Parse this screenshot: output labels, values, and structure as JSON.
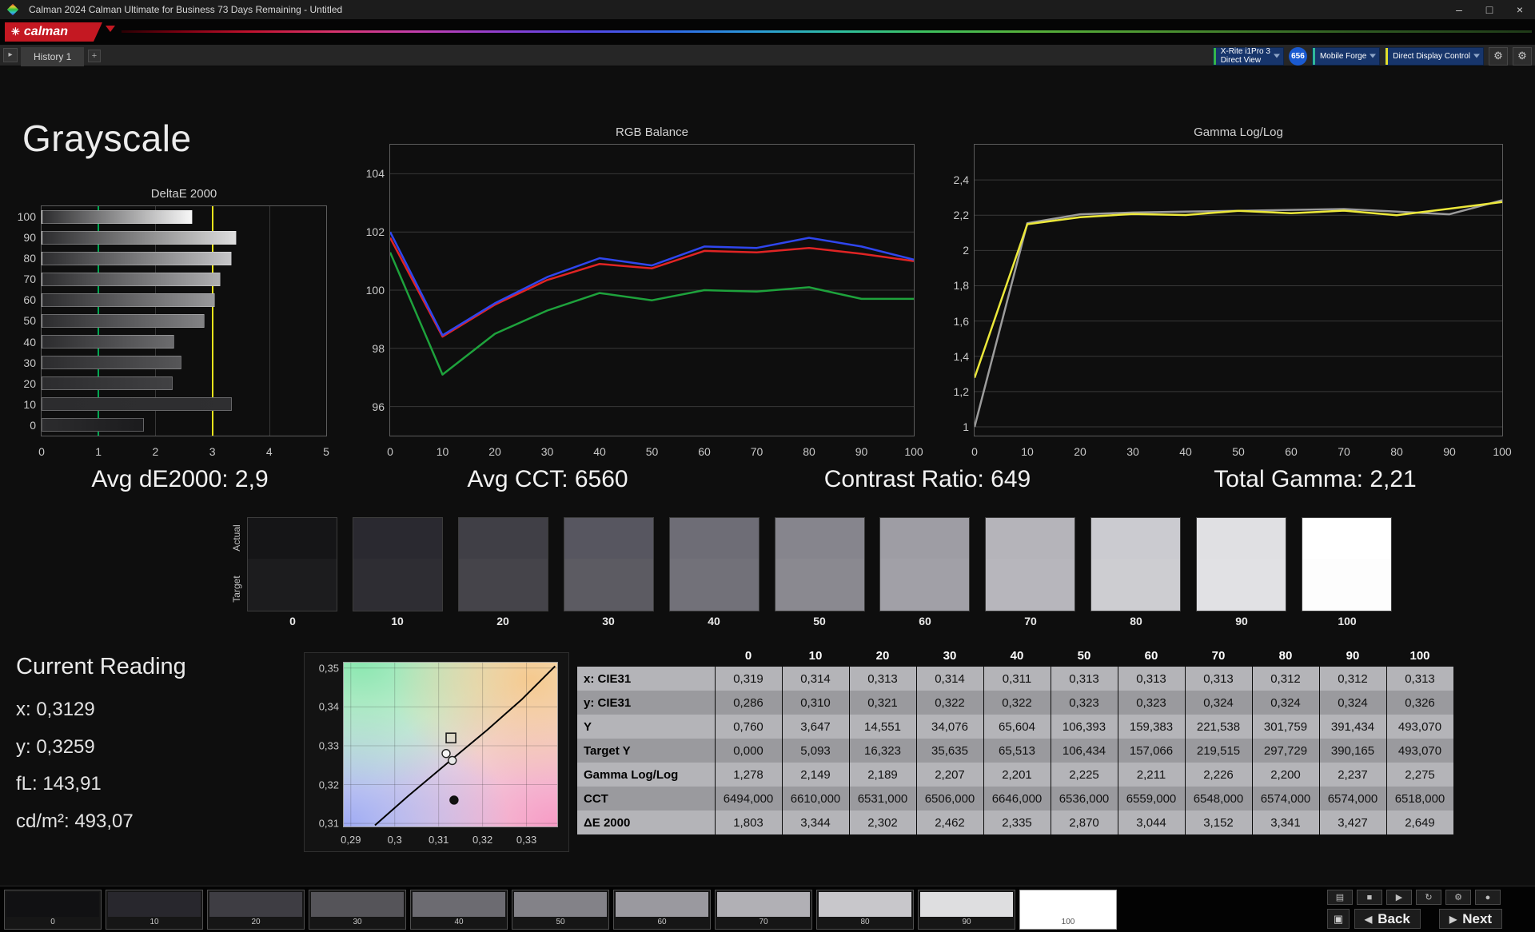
{
  "window": {
    "title": "Calman 2024 Calman Ultimate for Business 73 Days Remaining - Untitled"
  },
  "brand": {
    "name": "calman"
  },
  "tabbar": {
    "history_tab": "History 1",
    "meter": {
      "line1": "X-Rite i1Pro 3",
      "line2": "Direct View"
    },
    "session_badge": "656",
    "source": "Mobile Forge",
    "display_control": "Direct Display Control"
  },
  "page_title": "Grayscale",
  "summary": {
    "avg_de2000": "Avg dE2000: 2,9",
    "avg_cct": "Avg CCT: 6560",
    "contrast": "Contrast Ratio: 649",
    "total_gamma": "Total Gamma: 2,21"
  },
  "chart_data": [
    {
      "type": "bar",
      "title": "DeltaE 2000",
      "orientation": "horizontal",
      "categories": [
        "100",
        "90",
        "80",
        "70",
        "60",
        "50",
        "40",
        "30",
        "20",
        "10",
        "0"
      ],
      "values": [
        2.649,
        3.427,
        3.341,
        3.152,
        3.044,
        2.87,
        2.335,
        2.462,
        2.302,
        3.344,
        1.803
      ],
      "bar_colors": [
        "#f7f7f7",
        "#dddddd",
        "#c5c5c7",
        "#aeaeb0",
        "#98989a",
        "#828284",
        "#6c6c6e",
        "#565658",
        "#414143",
        "#2f2f31",
        "#1b1b1d"
      ],
      "xlim": [
        0,
        5
      ],
      "x_ticks": [
        "0",
        "1",
        "2",
        "3",
        "4",
        "5"
      ],
      "reference_lines": [
        {
          "value": 1,
          "color": "#00a651"
        },
        {
          "value": 3,
          "color": "#e8e41c"
        }
      ]
    },
    {
      "type": "line",
      "title": "RGB Balance",
      "x": [
        0,
        10,
        20,
        30,
        40,
        50,
        60,
        70,
        80,
        90,
        100
      ],
      "x_ticks": [
        "0",
        "10",
        "20",
        "30",
        "40",
        "50",
        "60",
        "70",
        "80",
        "90",
        "100"
      ],
      "ylim": [
        95,
        105
      ],
      "y_ticks": [
        "104",
        "102",
        "100",
        "98",
        "96"
      ],
      "y_tick_values": [
        104,
        102,
        100,
        98,
        96
      ],
      "series": [
        {
          "name": "Red",
          "color": "#e02424",
          "values": [
            101.8,
            98.4,
            99.5,
            100.35,
            100.9,
            100.75,
            101.35,
            101.3,
            101.45,
            101.25,
            101.0
          ]
        },
        {
          "name": "Green",
          "color": "#1ea23c",
          "values": [
            101.3,
            97.1,
            98.5,
            99.3,
            99.9,
            99.65,
            100.0,
            99.95,
            100.1,
            99.7,
            99.7
          ]
        },
        {
          "name": "Blue",
          "color": "#2f46ee",
          "values": [
            102.0,
            98.45,
            99.55,
            100.45,
            101.1,
            100.85,
            101.5,
            101.45,
            101.8,
            101.5,
            101.05
          ]
        }
      ]
    },
    {
      "type": "line",
      "title": "Gamma Log/Log",
      "x": [
        0,
        10,
        20,
        30,
        40,
        50,
        60,
        70,
        80,
        90,
        100
      ],
      "x_ticks": [
        "0",
        "10",
        "20",
        "30",
        "40",
        "50",
        "60",
        "70",
        "80",
        "90",
        "100"
      ],
      "ylim": [
        0.95,
        2.6
      ],
      "y_ticks": [
        "2,4",
        "2,2",
        "2",
        "1,8",
        "1,6",
        "1,4",
        "1,2",
        "1"
      ],
      "y_tick_values": [
        2.4,
        2.2,
        2.0,
        1.8,
        1.6,
        1.4,
        1.2,
        1.0
      ],
      "series": [
        {
          "name": "Target",
          "color": "#9c9c9c",
          "values": [
            1.0,
            2.155,
            2.205,
            2.215,
            2.22,
            2.225,
            2.23,
            2.235,
            2.22,
            2.205,
            2.285
          ]
        },
        {
          "name": "Measured",
          "color": "#ece83a",
          "values": [
            1.278,
            2.149,
            2.189,
            2.207,
            2.201,
            2.225,
            2.211,
            2.226,
            2.2,
            2.237,
            2.275
          ]
        }
      ]
    },
    {
      "type": "scatter",
      "xlim": [
        0.2884,
        0.337
      ],
      "ylim": [
        0.3092,
        0.3514
      ],
      "x_ticks": [
        "0,29",
        "0,3",
        "0,31",
        "0,32",
        "0,33"
      ],
      "x_tick_values": [
        0.29,
        0.3,
        0.31,
        0.32,
        0.33
      ],
      "y_ticks": [
        "0,35",
        "0,34",
        "0,33",
        "0,32",
        "0,31"
      ],
      "y_tick_values": [
        0.35,
        0.34,
        0.33,
        0.32,
        0.31
      ],
      "locus": [
        [
          0.2955,
          0.3095
        ],
        [
          0.303,
          0.317
        ],
        [
          0.3127,
          0.3262
        ],
        [
          0.321,
          0.334
        ],
        [
          0.329,
          0.342
        ],
        [
          0.3365,
          0.3505
        ]
      ],
      "points": [
        {
          "shape": "square",
          "x": 0.3128,
          "y": 0.332,
          "fill": "none",
          "stroke": "#1a1a1a"
        },
        {
          "shape": "circle",
          "x": 0.3117,
          "y": 0.328,
          "fill": "#f4f4f4",
          "stroke": "#222222"
        },
        {
          "shape": "circle",
          "x": 0.3131,
          "y": 0.3262,
          "fill": "#e8e8e8",
          "stroke": "#222222"
        },
        {
          "shape": "dot",
          "x": 0.3135,
          "y": 0.316,
          "fill": "#111111",
          "stroke": "#111111"
        }
      ]
    }
  ],
  "current_reading": {
    "title": "Current Reading",
    "lines": [
      "x: 0,3129",
      "y: 0,3259",
      "fL: 143,91",
      "cd/m²: 493,07"
    ]
  },
  "gray_ramp": {
    "row_labels": [
      "Actual",
      "Target"
    ],
    "levels": [
      "0",
      "10",
      "20",
      "30",
      "40",
      "50",
      "60",
      "70",
      "80",
      "90",
      "100"
    ],
    "actual_colors": [
      "#151517",
      "#2a2930",
      "#403f46",
      "#575660",
      "#6e6d76",
      "#86858d",
      "#9e9da4",
      "#b5b4ba",
      "#cbcbd0",
      "#e0e0e3",
      "#ffffff"
    ],
    "target_colors": [
      "#1c1c1e",
      "#2e2d33",
      "#45444a",
      "#5c5b62",
      "#727179",
      "#8a8990",
      "#a1a0a7",
      "#b7b6bc",
      "#cdcdd1",
      "#e1e1e4",
      "#fdfdfd"
    ]
  },
  "measurements_table": {
    "columns": [
      "0",
      "10",
      "20",
      "30",
      "40",
      "50",
      "60",
      "70",
      "80",
      "90",
      "100"
    ],
    "rows": [
      {
        "label": "x: CIE31",
        "values": [
          "0,319",
          "0,314",
          "0,313",
          "0,314",
          "0,311",
          "0,313",
          "0,313",
          "0,313",
          "0,312",
          "0,312",
          "0,313"
        ]
      },
      {
        "label": "y: CIE31",
        "values": [
          "0,286",
          "0,310",
          "0,321",
          "0,322",
          "0,322",
          "0,323",
          "0,323",
          "0,324",
          "0,324",
          "0,324",
          "0,326"
        ]
      },
      {
        "label": "Y",
        "values": [
          "0,760",
          "3,647",
          "14,551",
          "34,076",
          "65,604",
          "106,393",
          "159,383",
          "221,538",
          "301,759",
          "391,434",
          "493,070"
        ]
      },
      {
        "label": "Target Y",
        "values": [
          "0,000",
          "5,093",
          "16,323",
          "35,635",
          "65,513",
          "106,434",
          "157,066",
          "219,515",
          "297,729",
          "390,165",
          "493,070"
        ]
      },
      {
        "label": "Gamma Log/Log",
        "values": [
          "1,278",
          "2,149",
          "2,189",
          "2,207",
          "2,201",
          "2,225",
          "2,211",
          "2,226",
          "2,200",
          "2,237",
          "2,275"
        ]
      },
      {
        "label": "CCT",
        "values": [
          "6494,000",
          "6610,000",
          "6531,000",
          "6506,000",
          "6646,000",
          "6536,000",
          "6559,000",
          "6548,000",
          "6574,000",
          "6574,000",
          "6518,000"
        ]
      },
      {
        "label": "ΔE 2000",
        "values": [
          "1,803",
          "3,344",
          "2,302",
          "2,462",
          "2,335",
          "2,870",
          "3,044",
          "3,152",
          "3,341",
          "3,427",
          "2,649"
        ]
      }
    ]
  },
  "footer": {
    "levels": [
      "0",
      "10",
      "20",
      "30",
      "40",
      "50",
      "60",
      "70",
      "80",
      "90",
      "100"
    ],
    "colors": [
      "#111113",
      "#28272d",
      "#3e3d43",
      "#555459",
      "#6c6b71",
      "#838288",
      "#9a999f",
      "#b1b0b5",
      "#c8c7cb",
      "#dedee0",
      "#ffffff"
    ],
    "selected_index": 10,
    "back_label": "Back",
    "next_label": "Next"
  },
  "icons": {
    "minimize": "–",
    "maximize": "□",
    "close": "×",
    "gear": "⚙",
    "gear2": "⚙",
    "history_arrow": "▸",
    "add_tab": "+",
    "back": "◀",
    "next": "▶",
    "pattern_window": "▣",
    "logo_mark": "✳",
    "small_controls": [
      "▤",
      "■",
      "▶",
      "↻",
      "⚙",
      "●"
    ]
  }
}
